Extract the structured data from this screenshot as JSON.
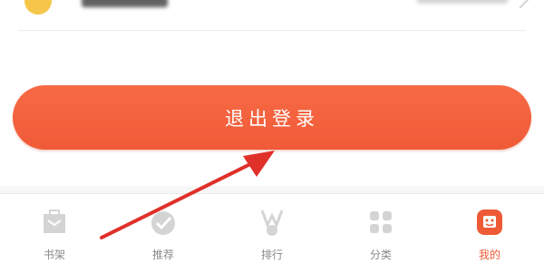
{
  "logout": {
    "label": "退出登录"
  },
  "tabbar": {
    "items": [
      {
        "label": "书架",
        "icon": "bookshelf-icon",
        "active": false
      },
      {
        "label": "推荐",
        "icon": "recommend-icon",
        "active": false
      },
      {
        "label": "排行",
        "icon": "ranking-icon",
        "active": false
      },
      {
        "label": "分类",
        "icon": "category-icon",
        "active": false
      },
      {
        "label": "我的",
        "icon": "profile-icon",
        "active": true
      }
    ]
  },
  "colors": {
    "accent": "#ee5a36",
    "button": "#f05a37",
    "annotation_arrow": "#e0302a"
  }
}
